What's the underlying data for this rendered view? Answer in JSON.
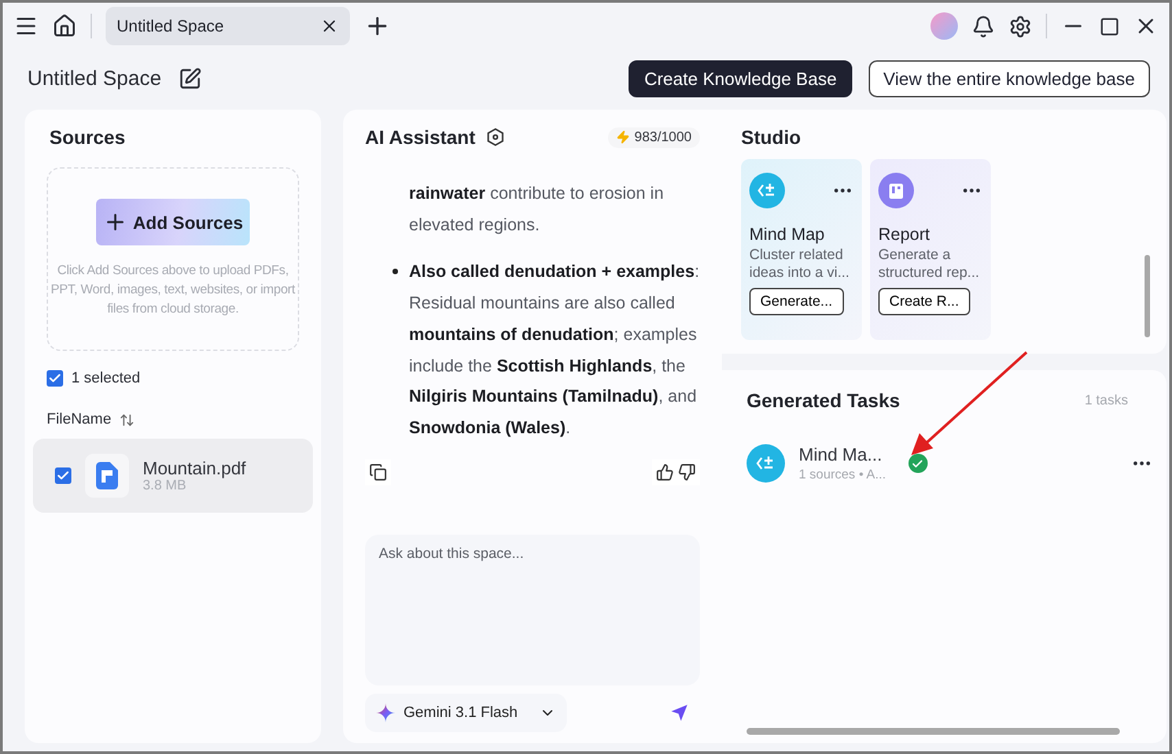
{
  "window": {
    "tab_title": "Untitled Space"
  },
  "header": {
    "title": "Untitled Space",
    "buttons": [
      {
        "label": "Create Knowledge Base",
        "kind": "primary"
      },
      {
        "label": "View the entire knowledge base",
        "kind": "outline"
      }
    ]
  },
  "sources": {
    "title": "Sources",
    "add_button": "Add Sources",
    "hint": "Click Add Sources above to upload PDFs, PPT, Word, images, text, websites, or import files from cloud storage.",
    "select_all": {
      "label": "1 selected",
      "checked": true
    },
    "column": "FileName",
    "files": [
      {
        "name": "Mountain.pdf",
        "size": "3.8 MB",
        "checked": true,
        "selected": true
      }
    ]
  },
  "assistant": {
    "title": "AI Assistant",
    "credits": "983/1000",
    "paragraphs": [
      {
        "kind": "plain",
        "text": "**rainwater** contribute to erosion in elevated regions."
      },
      {
        "kind": "bullet",
        "text": "**Also called denudation + examples**: Residual mountains are also called **mountains of denudation**; examples include the **Scottish Highlands**, the **Nilgiris Mountains (Tamilnadu)**, and **Snowdonia (Wales)**."
      }
    ],
    "input": {
      "placeholder": "Ask about this space..."
    },
    "model": "Gemini 3.1 Flash"
  },
  "studio": {
    "title": "Studio",
    "tools": [
      {
        "kind": "mindmap",
        "title": "Mind Map",
        "description": "Cluster related ideas into a vi...",
        "button": "Generate...",
        "color": "#22b5e3"
      },
      {
        "kind": "report",
        "title": "Report",
        "description": "Generate a structured rep...",
        "button": "Create R...",
        "color": "#8a7ef0"
      }
    ]
  },
  "tasks": {
    "title": "Generated Tasks",
    "count": "1 tasks",
    "items": [
      {
        "title": "Mind Ma...",
        "meta": "1 sources • A...",
        "done": true
      }
    ]
  }
}
